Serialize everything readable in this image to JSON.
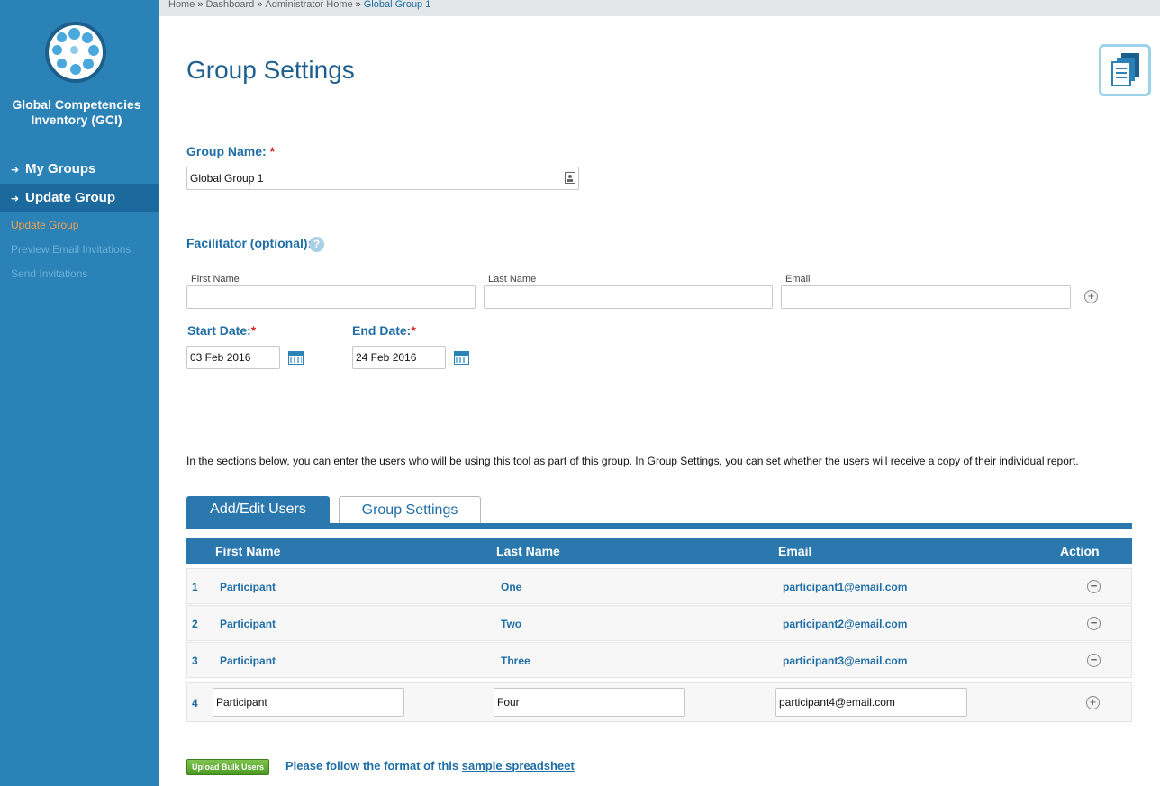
{
  "sidebar": {
    "app_title_line1": "Global Competencies",
    "app_title_line2": "Inventory (GCI)",
    "nav": [
      {
        "label": "My Groups",
        "icon": "arrow-right-icon"
      },
      {
        "label": "Update Group",
        "icon": "arrow-right-icon"
      }
    ],
    "subnav": [
      "Update Group",
      "Preview Email Invitations",
      "Send Invitations"
    ]
  },
  "breadcrumb": {
    "items": [
      "Home",
      "Dashboard",
      "Administrator Home"
    ],
    "current": "Global Group 1",
    "separator": "»"
  },
  "page": {
    "title": "Group Settings"
  },
  "form": {
    "group_name_label": "Group Name:",
    "required_mark": "*",
    "group_name_value": "Global Group 1",
    "facilitator_label": "Facilitator (optional):",
    "help_glyph": "?",
    "first_name_label": "First Name",
    "last_name_label": "Last Name",
    "email_label": "Email",
    "start_date_label": "Start Date:",
    "start_date_value": "03 Feb 2016",
    "end_date_label": "End Date:",
    "end_date_value": "24 Feb 2016",
    "plus_glyph": "+",
    "minus_glyph": "−"
  },
  "info_text": "In the sections below, you can enter the users who will be using this tool as part of this group. In Group Settings, you can set whether the users will receive a copy of their individual report.",
  "tabs": [
    "Add/Edit Users",
    "Group Settings"
  ],
  "table": {
    "headers": [
      "First Name",
      "Last Name",
      "Email",
      "Action"
    ],
    "rows": [
      {
        "num": "1",
        "first": "Participant",
        "last": "One",
        "email": "participant1@email.com"
      },
      {
        "num": "2",
        "first": "Participant",
        "last": "Two",
        "email": "participant2@email.com"
      },
      {
        "num": "3",
        "first": "Participant",
        "last": "Three",
        "email": "participant3@email.com"
      }
    ],
    "edit_row": {
      "num": "4",
      "first": "Participant",
      "last": "Four",
      "email": "participant4@email.com"
    }
  },
  "footer": {
    "upload_label": "Upload Bulk Users",
    "follow_text": "Please follow the format of this",
    "link_text": "sample spreadsheet"
  },
  "colors": {
    "sidebar": "#2a82b6",
    "accent": "#1f6ea6",
    "active_sub": "#f4a34a",
    "required": "#d9232a",
    "upload_green": "#5ea833"
  }
}
